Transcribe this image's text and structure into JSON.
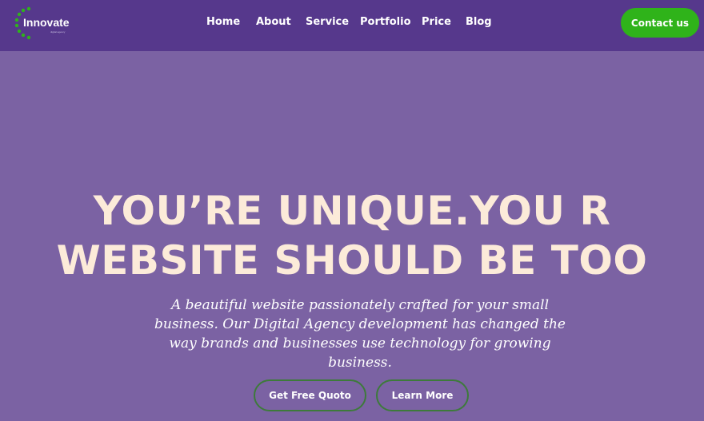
{
  "brand": {
    "name": "Innovate",
    "tagline": "digital agency",
    "accent_color": "#2fb31a"
  },
  "nav": {
    "items": [
      {
        "label": "Home"
      },
      {
        "label": "About"
      },
      {
        "label": "Service"
      },
      {
        "label": "Portfolio"
      },
      {
        "label": "Price"
      },
      {
        "label": "Blog"
      }
    ],
    "contact_label": "Contact us"
  },
  "hero": {
    "title_line1": "YOU’RE UNIQUE.YOU R",
    "title_line2": "WEBSITE SHOULD BE TOO",
    "subtitle": "A beautiful website passionately crafted for your small business. Our Digital Agency development has changed the way brands and businesses use technology for growing business.",
    "primary_label": "Get Free Quoto",
    "secondary_label": "Learn More"
  },
  "colors": {
    "navbar": "#56388c",
    "hero_bg": "#7b62a3",
    "title": "#fcebd9",
    "button_border": "#3d7a3a"
  }
}
